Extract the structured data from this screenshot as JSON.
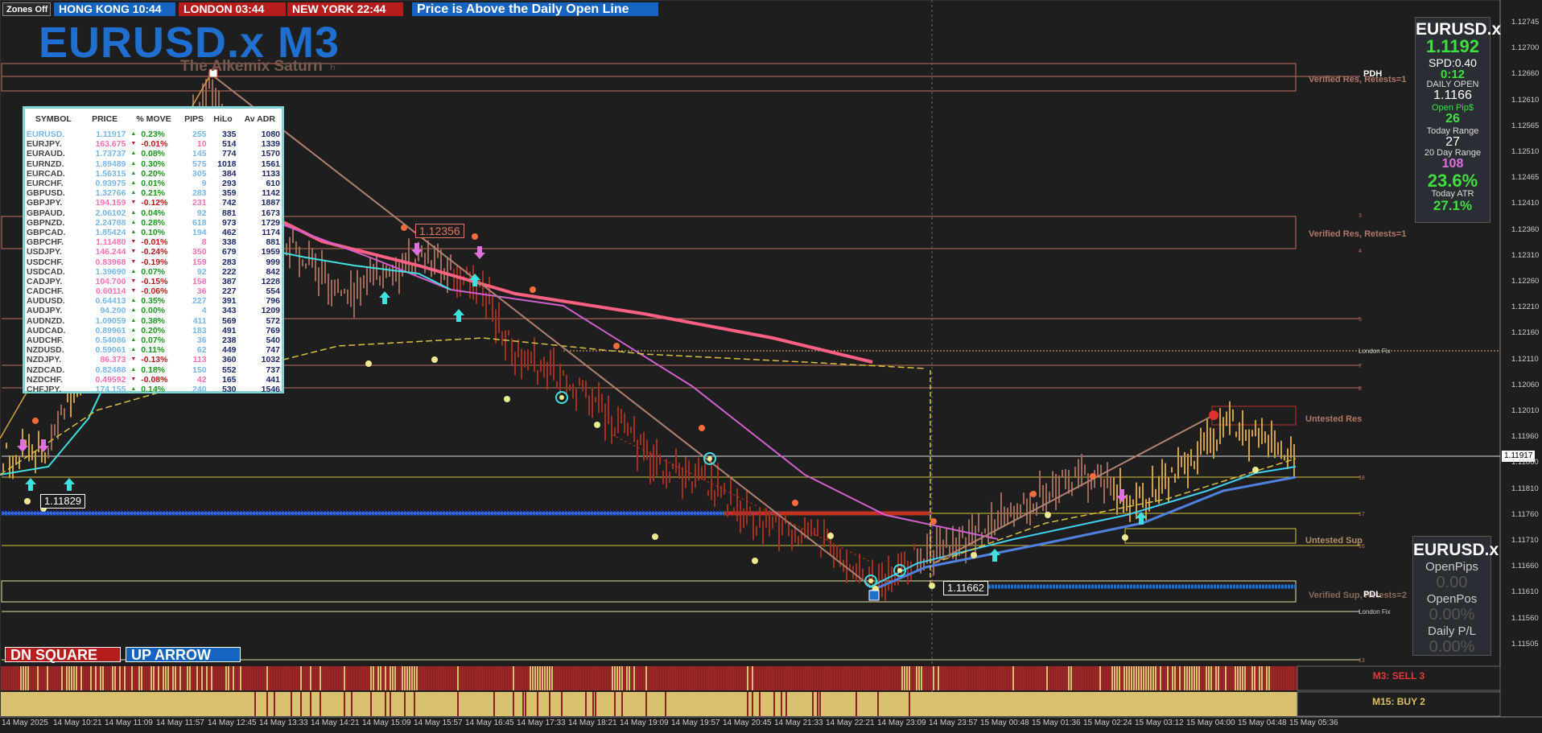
{
  "header": {
    "zones_button": "Zones Off",
    "hong_kong": "HONG KONG 10:44",
    "london": "LONDON  03:44",
    "new_york": "NEW YORK    22:44",
    "status": "Price is Above the Daily Open Line",
    "colors": {
      "hong_kong": "#1565c0",
      "london": "#b71c1c",
      "new_york": "#b71c1c",
      "status": "#1565c0"
    }
  },
  "chart": {
    "title": "EURUSD.x M3",
    "subtitle": "The Alkemix Saturn ♄",
    "current_price": "1.11917",
    "price_high_box": "1.12356",
    "price_low_box": "1.11662",
    "price_left_box": "1.11829"
  },
  "levels": {
    "pdh": "PDH",
    "verified_res_1": "Verified Res, Retests=1",
    "verified_res_2": "Verified Res, Retests=1",
    "london_fix_1": "London Fix",
    "untested_res": "Untested Res",
    "untested_sup": "Untested Sup",
    "pdl": "PDL",
    "verified_sup": "Verified Sup, Retests=2",
    "london_fix_2": "London Fix"
  },
  "price_axis": [
    "1.12745",
    "1.12700",
    "1.12660",
    "1.12610",
    "1.12565",
    "1.12510",
    "1.12465",
    "1.12410",
    "1.12360",
    "1.12310",
    "1.12260",
    "1.12210",
    "1.12160",
    "1.12110",
    "1.12060",
    "1.12010",
    "1.11960",
    "1.11860",
    "1.11810",
    "1.11760",
    "1.11710",
    "1.11660",
    "1.11610",
    "1.11560",
    "1.11505"
  ],
  "time_axis": [
    "14 May 2025",
    "14 May 10:21",
    "14 May 11:09",
    "14 May 11:57",
    "14 May 12:45",
    "14 May 13:33",
    "14 May 14:21",
    "14 May 15:09",
    "14 May 15:57",
    "14 May 16:45",
    "14 May 17:33",
    "14 May 18:21",
    "14 May 19:09",
    "14 May 19:57",
    "14 May 20:45",
    "14 May 21:33",
    "14 May 22:21",
    "14 May 23:09",
    "14 May 23:57",
    "15 May 00:48",
    "15 May 01:36",
    "15 May 02:24",
    "15 May 03:12",
    "15 May 04:00",
    "15 May 04:48",
    "15 May 05:36"
  ],
  "market_table": {
    "headers": [
      "SYMBOL",
      "PRICE",
      "% MOVE",
      "PIPS",
      "HiLo",
      "Av ADR"
    ],
    "rows": [
      {
        "sym": "EURUSD.",
        "price": "1.11917",
        "dir": "up",
        "move": "0.23%",
        "pips": "255",
        "hilo": "335",
        "adr": "1080",
        "tone": "blue"
      },
      {
        "sym": "EURJPY.",
        "price": "163.675",
        "dir": "dn",
        "move": "-0.01%",
        "pips": "10",
        "hilo": "514",
        "adr": "1339",
        "tone": "pink"
      },
      {
        "sym": "EURAUD.",
        "price": "1.73737",
        "dir": "up",
        "move": "0.08%",
        "pips": "145",
        "hilo": "774",
        "adr": "1570",
        "tone": "blue"
      },
      {
        "sym": "EURNZD.",
        "price": "1.89489",
        "dir": "up",
        "move": "0.30%",
        "pips": "575",
        "hilo": "1018",
        "adr": "1561",
        "tone": "blue"
      },
      {
        "sym": "EURCAD.",
        "price": "1.56315",
        "dir": "up",
        "move": "0.20%",
        "pips": "305",
        "hilo": "384",
        "adr": "1133",
        "tone": "blue"
      },
      {
        "sym": "EURCHF.",
        "price": "0.93975",
        "dir": "up",
        "move": "0.01%",
        "pips": "9",
        "hilo": "293",
        "adr": "610",
        "tone": "blue"
      },
      {
        "sym": "GBPUSD.",
        "price": "1.32766",
        "dir": "up",
        "move": "0.21%",
        "pips": "283",
        "hilo": "359",
        "adr": "1142",
        "tone": "blue"
      },
      {
        "sym": "GBPJPY.",
        "price": "194.159",
        "dir": "dn",
        "move": "-0.12%",
        "pips": "231",
        "hilo": "742",
        "adr": "1887",
        "tone": "pink"
      },
      {
        "sym": "GBPAUD.",
        "price": "2.06102",
        "dir": "up",
        "move": "0.04%",
        "pips": "92",
        "hilo": "881",
        "adr": "1673",
        "tone": "blue"
      },
      {
        "sym": "GBPNZD.",
        "price": "2.24788",
        "dir": "up",
        "move": "0.28%",
        "pips": "618",
        "hilo": "973",
        "adr": "1729",
        "tone": "blue"
      },
      {
        "sym": "GBPCAD.",
        "price": "1.85424",
        "dir": "up",
        "move": "0.10%",
        "pips": "194",
        "hilo": "462",
        "adr": "1174",
        "tone": "blue"
      },
      {
        "sym": "GBPCHF.",
        "price": "1.11480",
        "dir": "dn",
        "move": "-0.01%",
        "pips": "8",
        "hilo": "338",
        "adr": "881",
        "tone": "pink"
      },
      {
        "sym": "USDJPY.",
        "price": "146.244",
        "dir": "dn",
        "move": "-0.24%",
        "pips": "350",
        "hilo": "679",
        "adr": "1959",
        "tone": "pink"
      },
      {
        "sym": "USDCHF.",
        "price": "0.83968",
        "dir": "dn",
        "move": "-0.19%",
        "pips": "159",
        "hilo": "283",
        "adr": "999",
        "tone": "pink"
      },
      {
        "sym": "USDCAD.",
        "price": "1.39690",
        "dir": "up",
        "move": "0.07%",
        "pips": "92",
        "hilo": "222",
        "adr": "842",
        "tone": "blue"
      },
      {
        "sym": "CADJPY.",
        "price": "104.700",
        "dir": "dn",
        "move": "-0.15%",
        "pips": "158",
        "hilo": "387",
        "adr": "1228",
        "tone": "pink"
      },
      {
        "sym": "CADCHF.",
        "price": "0.60114",
        "dir": "dn",
        "move": "-0.06%",
        "pips": "36",
        "hilo": "227",
        "adr": "554",
        "tone": "pink"
      },
      {
        "sym": "AUDUSD.",
        "price": "0.64413",
        "dir": "up",
        "move": "0.35%",
        "pips": "227",
        "hilo": "391",
        "adr": "796",
        "tone": "blue"
      },
      {
        "sym": "AUDJPY.",
        "price": "94.200",
        "dir": "up",
        "move": "0.00%",
        "pips": "4",
        "hilo": "343",
        "adr": "1209",
        "tone": "blue"
      },
      {
        "sym": "AUDNZD.",
        "price": "1.09059",
        "dir": "up",
        "move": "0.38%",
        "pips": "411",
        "hilo": "569",
        "adr": "572",
        "tone": "blue"
      },
      {
        "sym": "AUDCAD.",
        "price": "0.89961",
        "dir": "up",
        "move": "0.20%",
        "pips": "183",
        "hilo": "491",
        "adr": "769",
        "tone": "blue"
      },
      {
        "sym": "AUDCHF.",
        "price": "0.54086",
        "dir": "up",
        "move": "0.07%",
        "pips": "36",
        "hilo": "238",
        "adr": "540",
        "tone": "blue"
      },
      {
        "sym": "NZDUSD.",
        "price": "0.59061",
        "dir": "up",
        "move": "0.11%",
        "pips": "62",
        "hilo": "449",
        "adr": "747",
        "tone": "blue"
      },
      {
        "sym": "NZDJPY.",
        "price": "86.373",
        "dir": "dn",
        "move": "-0.13%",
        "pips": "113",
        "hilo": "360",
        "adr": "1032",
        "tone": "pink"
      },
      {
        "sym": "NZDCAD.",
        "price": "0.82488",
        "dir": "up",
        "move": "0.18%",
        "pips": "150",
        "hilo": "552",
        "adr": "737",
        "tone": "blue"
      },
      {
        "sym": "NZDCHF.",
        "price": "0.49592",
        "dir": "dn",
        "move": "-0.08%",
        "pips": "42",
        "hilo": "165",
        "adr": "441",
        "tone": "pink"
      },
      {
        "sym": "CHFJPY.",
        "price": "174.155",
        "dir": "up",
        "move": "0.14%",
        "pips": "240",
        "hilo": "530",
        "adr": "1546",
        "tone": "blue"
      }
    ]
  },
  "info_panel": {
    "symbol": "EURUSD.x",
    "price": "1.1192",
    "spread": "SPD:0.40",
    "timer": "0:12",
    "daily_open_label": "DAILY OPEN",
    "daily_open": "1.1166",
    "open_pips_label": "Open Pip$",
    "open_pips": "26",
    "today_range_label": "Today Range",
    "today_range": "27",
    "twenty_day_label": "20 Day Range",
    "twenty_day": "108",
    "pct_big": "23.6%",
    "atr_label": "Today ATR",
    "atr": "27.1%"
  },
  "position_panel": {
    "symbol": "EURUSD.x",
    "open_pips_label": "OpenPips",
    "open_pips": "0.00",
    "open_pos_label": "OpenPos",
    "open_pos": "0.00%",
    "daily_pl_label": "Daily P/L",
    "daily_pl": "0.00%"
  },
  "buttons": {
    "dn_square": "DN SQUARE",
    "up_arrow": "UP ARROW"
  },
  "signals": {
    "m3": "M3: SELL 3",
    "m15": "M15: BUY 2"
  }
}
